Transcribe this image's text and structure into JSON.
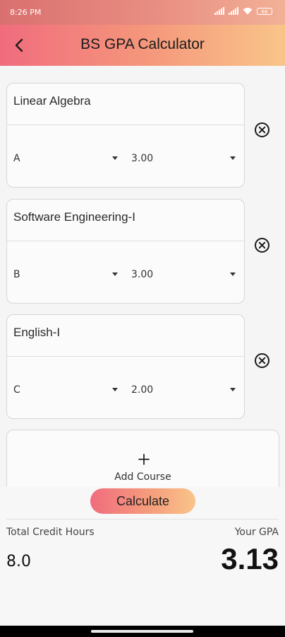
{
  "status": {
    "time": "8:26 PM",
    "battery": "66"
  },
  "app": {
    "title": "BS GPA Calculator"
  },
  "courses": [
    {
      "name": "Linear Algebra",
      "grade": "A",
      "credit": "3.00"
    },
    {
      "name": "Software Engineering-I",
      "grade": "B",
      "credit": "3.00"
    },
    {
      "name": "English-I",
      "grade": "C",
      "credit": "2.00"
    }
  ],
  "add_course": {
    "label": "Add Course"
  },
  "calculate": {
    "label": "Calculate"
  },
  "summary": {
    "credit_label": "Total Credit Hours",
    "credit_value": "8.0",
    "gpa_label": "Your GPA",
    "gpa_value": "3.13"
  },
  "colors": {
    "accent_start": "#f06c7d",
    "accent_end": "#f9c58a"
  }
}
